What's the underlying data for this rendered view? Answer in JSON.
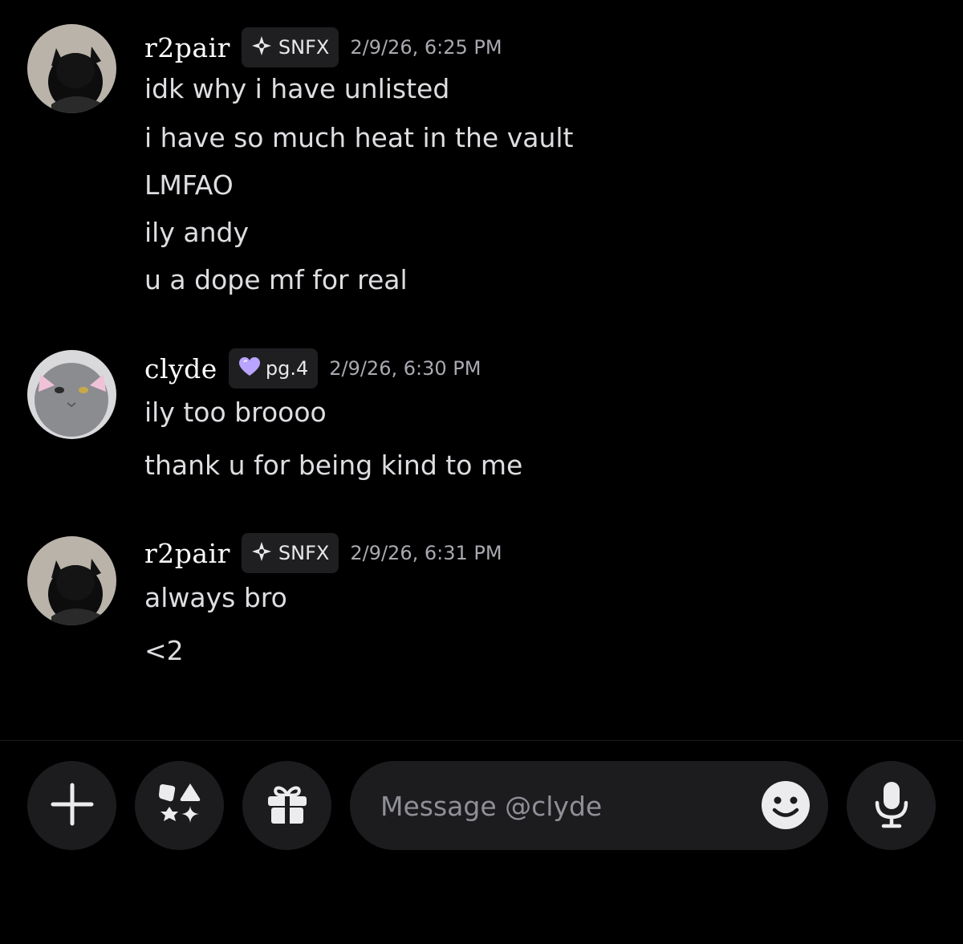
{
  "messages": [
    {
      "author": "r2pair",
      "tag": {
        "label": "SNFX",
        "icon": "diamond-sparkle-icon"
      },
      "timestamp": "2/9/26, 6:25 PM",
      "lines": [
        "idk why i have unlisted",
        "i have so much heat in the vault",
        "LMFAO",
        "ily andy",
        "u a dope mf for real"
      ]
    },
    {
      "author": "clyde",
      "tag": {
        "label": "pg.4",
        "icon": "purple-heart-icon"
      },
      "timestamp": "2/9/26, 6:30 PM",
      "lines": [
        "ily too broooo",
        "thank u for being kind to me"
      ]
    },
    {
      "author": "r2pair",
      "tag": {
        "label": "SNFX",
        "icon": "diamond-sparkle-icon"
      },
      "timestamp": "2/9/26, 6:31 PM",
      "lines": [
        "always bro",
        "<2"
      ]
    }
  ],
  "composer": {
    "placeholder": "Message @clyde",
    "buttons": [
      "plus-icon",
      "apps-icon",
      "gift-icon",
      "emoji-icon",
      "microphone-icon"
    ]
  },
  "colors": {
    "background": "#000000",
    "surface": "#1c1c1f",
    "tag_bg": "#1f1f22",
    "heart": "#b9a4ff"
  }
}
